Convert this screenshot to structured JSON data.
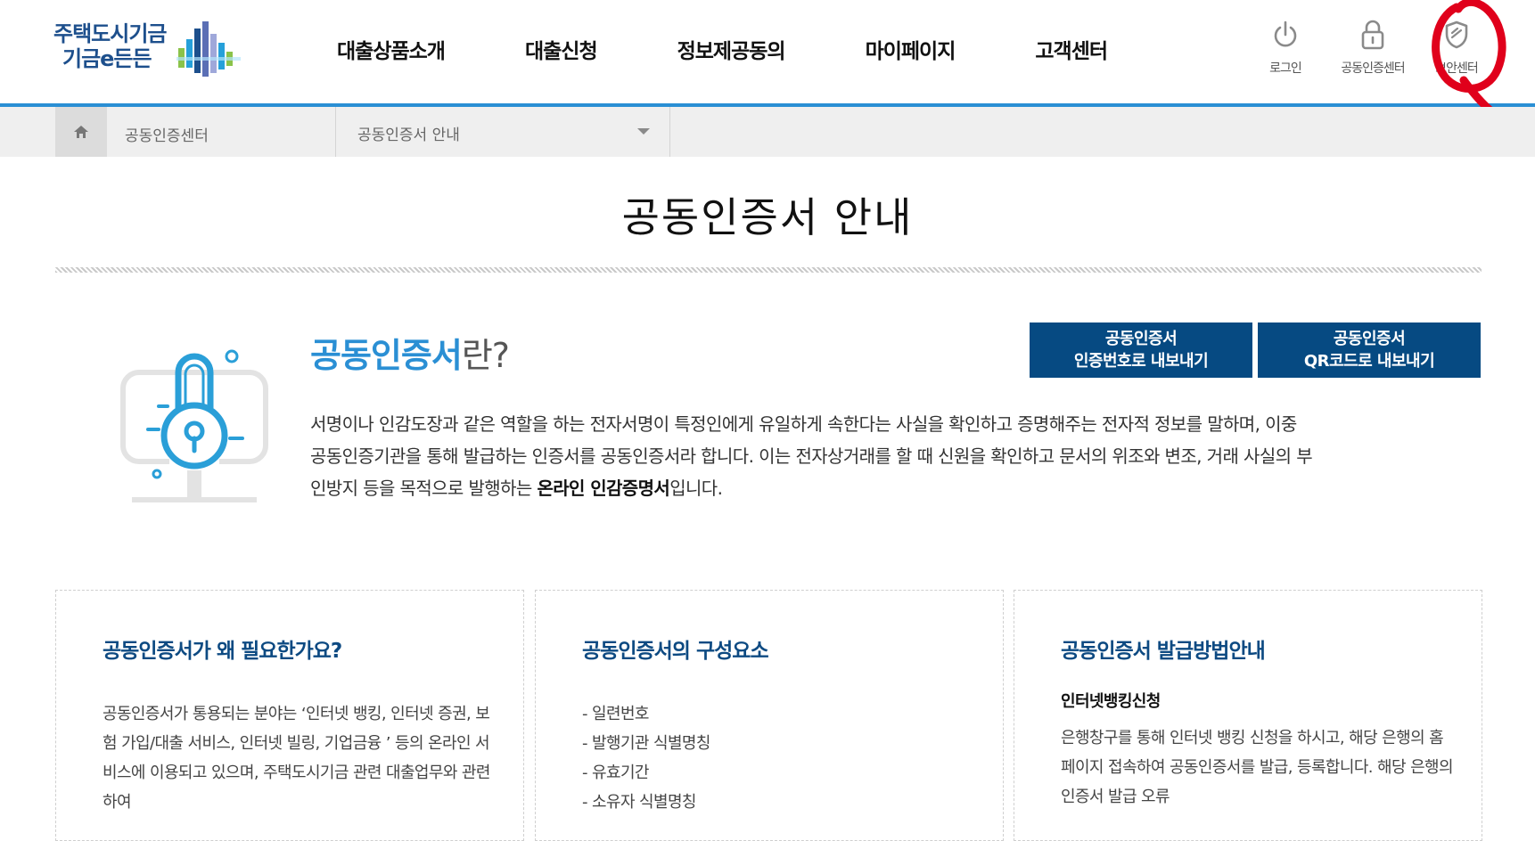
{
  "logo": {
    "line1": "주택도시기금",
    "line2": "기금e든든"
  },
  "gnb": [
    "대출상품소개",
    "대출신청",
    "정보제공동의",
    "마이페이지",
    "고객센터"
  ],
  "util": [
    {
      "label": "로그인",
      "icon": "power-icon"
    },
    {
      "label": "공동인증센터",
      "icon": "lock-icon"
    },
    {
      "label": "보안센터",
      "icon": "shield-icon"
    }
  ],
  "location": {
    "home_icon": "home-icon",
    "depth1": "공동인증센터",
    "depth2": "공동인증서 안내"
  },
  "page": {
    "title": "공동인증서 안내"
  },
  "intro": {
    "heading_strong": "공동인증서",
    "heading_rest": "란?",
    "text_plain": "서명이나 인감도장과 같은 역할을 하는 전자서명이 특정인에게 유일하게 속한다는 사실을 확인하고 증명해주는 전자적 정보를 말하며, 이중 공동인증기관을 통해 발급하는 인증서를 공동인증서라 합니다. 이는 전자상거래를 할 때 신원을 확인하고 문서의 위조와 변조, 거래 사실의 부인방지 등을 목적으로 발행하는 ",
    "text_bold": "온라인 인감증명서",
    "text_end": "입니다."
  },
  "buttons": [
    {
      "line1": "공동인증서",
      "line2": "인증번호로 내보내기"
    },
    {
      "line1": "공동인증서",
      "line2": "QR코드로 내보내기"
    }
  ],
  "cards": [
    {
      "title": "공동인증서가 왜 필요한가요?",
      "text": "공동인증서가 통용되는 분야는 ‘인터넷 뱅킹, 인터넷 증권, 보험 가입/대출 서비스, 인터넷 빌링, 기업금융 ’ 등의 온라인 서비스에 이용되고 있으며, 주택도시기금 관련 대출업무와 관련하여"
    },
    {
      "title": "공동인증서의 구성요소",
      "items": [
        "일련번호",
        "발행기관 식별명칭",
        "유효기간",
        "소유자 식별명칭"
      ]
    },
    {
      "title": "공동인증서 발급방법안내",
      "subtitle": "인터넷뱅킹신청",
      "text": "은행창구를 통해 인터넷 뱅킹 신청을 하시고, 해당 은행의 홈페이지 접속하여 공동인증서를 발급, 등록합니다. 해당 은행의 인증서 발급 오류"
    }
  ],
  "colors": {
    "accent": "#2a8fd4",
    "navy": "#064a82",
    "card_title": "#0d4a82",
    "annotation": "#e0001b"
  }
}
